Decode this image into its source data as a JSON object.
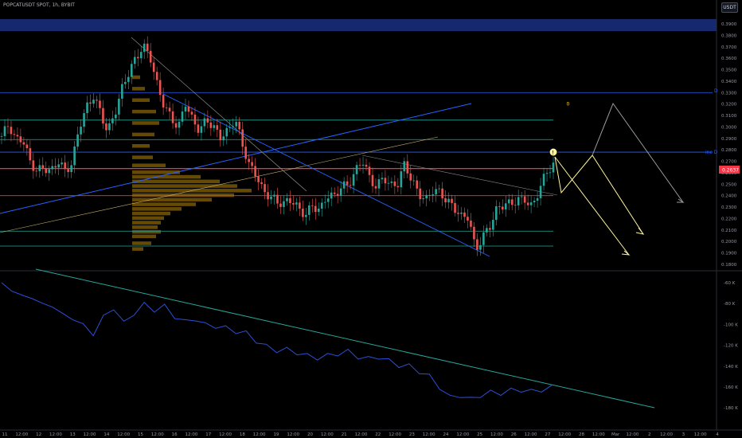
{
  "header": {
    "symbol_title": "POPCATUSDT SPOT, 1h, BYBIT",
    "currency_button": "USDT"
  },
  "colors": {
    "background": "#000000",
    "up_candle": "#26a69a",
    "down_candle": "#ef5350",
    "blue_line": "#2962ff",
    "teal_line": "#26a69a",
    "red_level": "#f23645",
    "volume_profile": "#b8860b",
    "projection_yellow": "#fff59d",
    "projection_gray": "#9e9e9e",
    "indicator_line": "#2f4fd8",
    "price_label_bg": "#f23645"
  },
  "labels": {
    "current_price": "0.2637",
    "inc_d": "inc D",
    "d": "D",
    "zero_marker": "0"
  },
  "chart_data": [
    {
      "type": "candlestick",
      "title": "POPCATUSDT SPOT, 1h, BYBIT",
      "y_ticks": [
        "0.3900",
        "0.3800",
        "0.3700",
        "0.3600",
        "0.3500",
        "0.3400",
        "0.3300",
        "0.3200",
        "0.3100",
        "0.3000",
        "0.2900",
        "0.2800",
        "0.2700",
        "0.2600",
        "0.2500",
        "0.2400",
        "0.2300",
        "0.2200",
        "0.2100",
        "0.2000",
        "0.1900",
        "0.1800"
      ],
      "ylim": [
        0.18,
        0.39
      ],
      "x_ticks": [
        "11",
        "12:00",
        "12",
        "12:00",
        "13",
        "12:00",
        "14",
        "12:00",
        "15",
        "12:00",
        "16",
        "12:00",
        "17",
        "12:00",
        "18",
        "12:00",
        "19",
        "12:00",
        "20",
        "12:00",
        "21",
        "12:00",
        "22",
        "12:00",
        "23",
        "12:00",
        "24",
        "12:00",
        "25",
        "12:00",
        "26",
        "12:00",
        "27",
        "12:00",
        "28",
        "12:00",
        "Mar",
        "12:00",
        "2",
        "12:00",
        "3",
        "12:00",
        "4"
      ],
      "close_path": [
        [
          0,
          0.292
        ],
        [
          1,
          0.3
        ],
        [
          2,
          0.285
        ],
        [
          3,
          0.288
        ],
        [
          4,
          0.27
        ],
        [
          5,
          0.264
        ],
        [
          6,
          0.268
        ],
        [
          7,
          0.262
        ],
        [
          8,
          0.27
        ],
        [
          9,
          0.258
        ],
        [
          10,
          0.266
        ],
        [
          11,
          0.3
        ],
        [
          12,
          0.318
        ],
        [
          13,
          0.33
        ],
        [
          14,
          0.315
        ],
        [
          15,
          0.296
        ],
        [
          16,
          0.31
        ],
        [
          17,
          0.33
        ],
        [
          18,
          0.346
        ],
        [
          19,
          0.36
        ],
        [
          20,
          0.373
        ],
        [
          21,
          0.365
        ],
        [
          22,
          0.338
        ],
        [
          23,
          0.318
        ],
        [
          24,
          0.305
        ],
        [
          25,
          0.296
        ],
        [
          26,
          0.32
        ],
        [
          27,
          0.306
        ],
        [
          28,
          0.3
        ],
        [
          29,
          0.31
        ],
        [
          30,
          0.3
        ],
        [
          31,
          0.29
        ],
        [
          32,
          0.293
        ],
        [
          33,
          0.305
        ],
        [
          34,
          0.285
        ],
        [
          35,
          0.268
        ],
        [
          36,
          0.262
        ],
        [
          37,
          0.245
        ],
        [
          38,
          0.24
        ],
        [
          39,
          0.232
        ],
        [
          40,
          0.23
        ],
        [
          41,
          0.235
        ],
        [
          42,
          0.228
        ],
        [
          43,
          0.226
        ],
        [
          44,
          0.235
        ],
        [
          45,
          0.228
        ],
        [
          46,
          0.24
        ],
        [
          47,
          0.236
        ],
        [
          48,
          0.245
        ],
        [
          49,
          0.248
        ],
        [
          50,
          0.262
        ],
        [
          51,
          0.275
        ],
        [
          52,
          0.258
        ],
        [
          53,
          0.248
        ],
        [
          54,
          0.255
        ],
        [
          55,
          0.245
        ],
        [
          56,
          0.248
        ],
        [
          57,
          0.268
        ],
        [
          58,
          0.255
        ],
        [
          59,
          0.245
        ],
        [
          60,
          0.238
        ],
        [
          61,
          0.245
        ],
        [
          62,
          0.24
        ],
        [
          63,
          0.232
        ],
        [
          64,
          0.228
        ],
        [
          65,
          0.222
        ],
        [
          66,
          0.225
        ],
        [
          67,
          0.195
        ],
        [
          68,
          0.205
        ],
        [
          69,
          0.212
        ],
        [
          70,
          0.225
        ],
        [
          71,
          0.23
        ],
        [
          72,
          0.232
        ],
        [
          73,
          0.238
        ],
        [
          74,
          0.24
        ],
        [
          75,
          0.232
        ],
        [
          76,
          0.246
        ],
        [
          77,
          0.258
        ],
        [
          78,
          0.264
        ]
      ],
      "price_levels": [
        {
          "value": 0.39,
          "type": "zone"
        },
        {
          "value": 0.33,
          "type": "line",
          "label": "D"
        },
        {
          "value": 0.306,
          "type": "line"
        },
        {
          "value": 0.289,
          "type": "line"
        },
        {
          "value": 0.278,
          "type": "line",
          "label": "inc D"
        },
        {
          "value": 0.2637,
          "type": "current"
        },
        {
          "value": 0.24,
          "type": "red"
        },
        {
          "value": 0.209,
          "type": "line"
        },
        {
          "value": 0.196,
          "type": "line"
        }
      ]
    },
    {
      "type": "line",
      "title": "",
      "y_ticks": [
        "-60 K",
        "-80 K",
        "-100 K",
        "-120 K",
        "-140 K",
        "-160 K",
        "-180 K"
      ],
      "ylim": [
        -190000,
        -55000
      ],
      "series": [
        {
          "values": [
            -60000,
            -68000,
            -72000,
            -75000,
            -80000,
            -83000,
            -90000,
            -95000,
            -100000,
            -110000,
            -92000,
            -85000,
            -98000,
            -90000,
            -80000,
            -87000,
            -82000,
            -93000,
            -97000,
            -95000,
            -100000,
            -102000,
            -103000,
            -107000,
            -108000,
            -116000,
            -121000,
            -125000,
            -124000,
            -127000,
            -130000,
            -132000,
            -130000,
            -128000,
            -126000,
            -131000,
            -133000,
            -131000,
            -135000,
            -139000,
            -140000,
            -145000,
            -150000,
            -160000,
            -170000,
            -168000,
            -172000,
            -168000,
            -165000,
            -166000,
            -163000,
            -163000,
            -164000,
            -163000,
            -160000
          ]
        }
      ]
    }
  ]
}
